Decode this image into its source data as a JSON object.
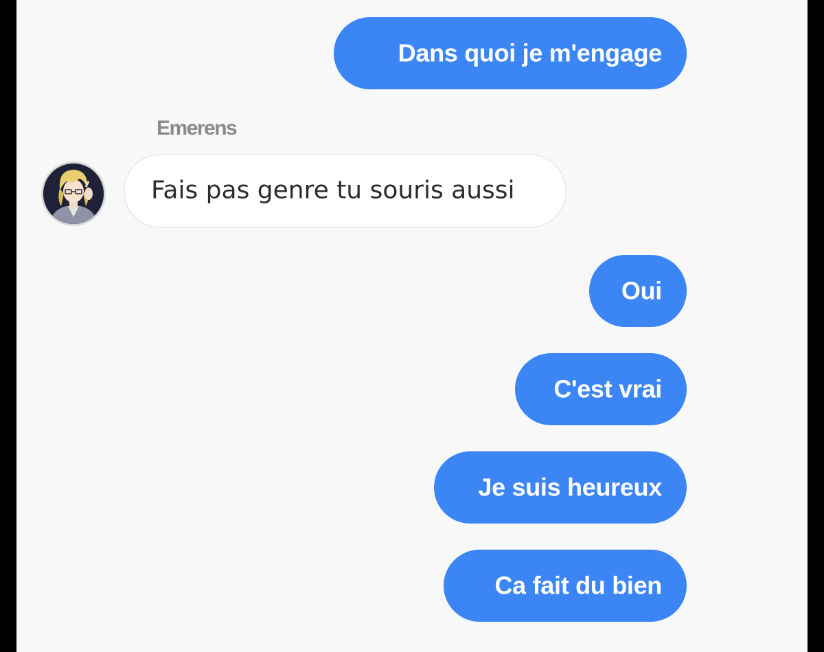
{
  "conversation": {
    "contact_name": "Emerens",
    "messages": [
      {
        "direction": "outgoing",
        "text": "Dans quoi je m'engage"
      },
      {
        "direction": "incoming",
        "text": "Fais pas genre tu souris aussi"
      },
      {
        "direction": "outgoing",
        "text": "Oui"
      },
      {
        "direction": "outgoing",
        "text": "C'est vrai"
      },
      {
        "direction": "outgoing",
        "text": "Je suis heureux"
      },
      {
        "direction": "outgoing",
        "text": "Ca fait du bien"
      }
    ]
  },
  "colors": {
    "outgoing_bubble": "#3b86f4",
    "incoming_bubble": "#ffffff",
    "background": "#f8f8f8",
    "sender_name": "#8a8a8a"
  },
  "icons": {
    "avatar": "avatar-blonde-character"
  }
}
